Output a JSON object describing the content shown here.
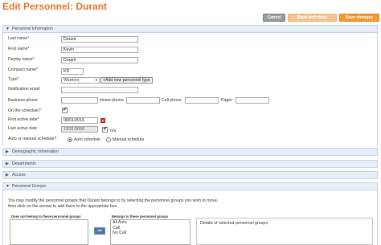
{
  "page": {
    "title": "Edit Personnel: Durant"
  },
  "toolbar": {
    "cancel_label": "Cancel",
    "save_close_label": "Save and close",
    "save_label": "Save changes"
  },
  "colors": {
    "accent_orange": "#e8732a",
    "section_bg": "#e6eef8",
    "save_button": "#f39a2e"
  },
  "personnel_info": {
    "header": "Personnel Information",
    "last_name": {
      "label": "Last name*",
      "value": "Durant"
    },
    "first_name": {
      "label": "First name*",
      "value": "Kevin"
    },
    "display_name": {
      "label": "Deplay name*",
      "value": "Durant"
    },
    "compact_name": {
      "label": "Compact name*",
      "value": "KD"
    },
    "type": {
      "label": "Type*",
      "value": "Warriors",
      "add_button": "+Add new personnel type"
    },
    "notification_email": {
      "label": "Notification email",
      "value": ""
    },
    "business_phone": {
      "label": "Business phone",
      "value": ""
    },
    "home_phone": {
      "label": "Home phone",
      "value": ""
    },
    "cell_phone": {
      "label": "Cell phone",
      "value": ""
    },
    "pager": {
      "label": "Pager",
      "value": ""
    },
    "on_schedule": {
      "label": "On the schedule?",
      "checked": true
    },
    "first_active_date": {
      "label": "First active date*",
      "value": "08/01/2016"
    },
    "last_active_date": {
      "label": "Last active date",
      "value": "12/31/3000",
      "na_label": "n/a",
      "na_checked": true
    },
    "schedule_mode": {
      "label": "Auto or manual schedule?",
      "auto_label": "Auto schedule",
      "manual_label": "Manual schedule",
      "selected": "auto"
    }
  },
  "sections": {
    "demographic": "Demographic information",
    "departments": "Departments",
    "access": "Access",
    "groups": "Personnel Groups"
  },
  "groups": {
    "instructions_line1": "You may modify the personnel groups that Durant belongs to by selecting the personnel groups you wish to move,",
    "instructions_line2": "then click on the arrows to add them to the appropriate box.",
    "not_member_caption": "Does not belong to these personnel groups",
    "member_caption": "Belongs to these personnel groups",
    "member_options": [
      "All Auto",
      "Call",
      "No Call"
    ],
    "move_arrow": "⇒",
    "details_label": "Details of selected personnel groups:"
  }
}
